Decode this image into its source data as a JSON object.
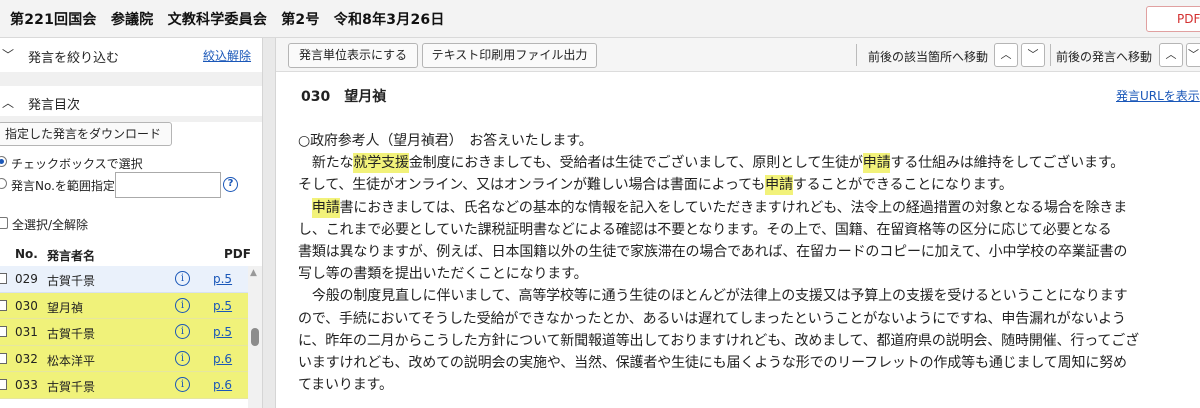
{
  "header": {
    "title": "第221回国会　参議院　文教科学委員会　第2号　令和8年3月26日",
    "pdf_label": "PDF"
  },
  "left_panel": {
    "filter_label": "発言を絞り込む",
    "filter_reset": "絞込解除",
    "toc_label": "発言目次",
    "download_button": "指定した発言をダウンロード",
    "radio_checkbox": "チェックボックスで選択",
    "radio_range": "発言No.を範囲指定",
    "range_value": "",
    "help_icon": "?",
    "select_all": "全選択/全解除",
    "columns": {
      "no": "No.",
      "name": "発言者名",
      "pdf": "PDF"
    },
    "speeches": [
      {
        "no": "029",
        "name": "古賀千景",
        "info": "i",
        "pdf": "p.5",
        "highlighted": false
      },
      {
        "no": "030",
        "name": "望月禎",
        "info": "i",
        "pdf": "p.5",
        "highlighted": true
      },
      {
        "no": "031",
        "name": "古賀千景",
        "info": "i",
        "pdf": "p.5",
        "highlighted": true
      },
      {
        "no": "032",
        "name": "松本洋平",
        "info": "i",
        "pdf": "p.6",
        "highlighted": true
      },
      {
        "no": "033",
        "name": "古賀千景",
        "info": "i",
        "pdf": "p.6",
        "highlighted": true
      }
    ]
  },
  "toolbar": {
    "unit_display": "発言単位表示にする",
    "text_export": "テキスト印刷用ファイル出力",
    "prev_next_match": "前後の該当箇所へ移動",
    "prev_next_speech": "前後の発言へ移動",
    "up_symbol": "︿",
    "down_symbol": "﹀"
  },
  "speech": {
    "header": "030　望月禎",
    "url_link": "発言URLを表示",
    "lines": [
      [
        {
          "t": "○政府参考人（望月禎君）　お答えいたします。"
        }
      ],
      [
        {
          "t": "　新たな"
        },
        {
          "t": "就学支援",
          "hl": true
        },
        {
          "t": "金制度におきましても、受給者は生徒でございまして、原則として生徒が"
        },
        {
          "t": "申請",
          "hl": true
        },
        {
          "t": "する仕組みは維持をしてございます。"
        }
      ],
      [
        {
          "t": "そして、生徒がオンライン、又はオンラインが難しい場合は書面によっても"
        },
        {
          "t": "申請",
          "hl": true
        },
        {
          "t": "することができることになります。"
        }
      ],
      [
        {
          "t": "　"
        },
        {
          "t": "申請",
          "hl": true
        },
        {
          "t": "書におきましては、氏名などの基本的な情報を記入をしていただきますけれども、法令上の経過措置の対象となる場合を除きま"
        }
      ],
      [
        {
          "t": "し、これまで必要としていた課税証明書などによる確認は不要となります。その上で、国籍、在留資格等の区分に応じて必要となる"
        }
      ],
      [
        {
          "t": "書類は異なりますが、例えば、日本国籍以外の生徒で家族滞在の場合であれば、在留カードのコピーに加えて、小中学校の卒業証書の"
        }
      ],
      [
        {
          "t": "写し等の書類を提出いただくことになります。"
        }
      ],
      [
        {
          "t": "　今般の制度見直しに伴いまして、高等学校等に通う生徒のほとんどが法律上の支援又は予算上の支援を受けるということになります"
        }
      ],
      [
        {
          "t": "ので、手続においてそうした受給ができなかったとか、あるいは遅れてしまったということがないようにですね、申告漏れがないよう"
        }
      ],
      [
        {
          "t": "に、昨年の二月からこうした方針について新聞報道等出しておりますけれども、改めまして、都道府県の説明会、随時開催、行ってござ"
        }
      ],
      [
        {
          "t": "いますけれども、改めての説明会の実施や、当然、保護者や生徒にも届くような形でのリーフレットの作成等も通じまして周知に努め"
        }
      ],
      [
        {
          "t": "てまいります。"
        }
      ]
    ]
  }
}
